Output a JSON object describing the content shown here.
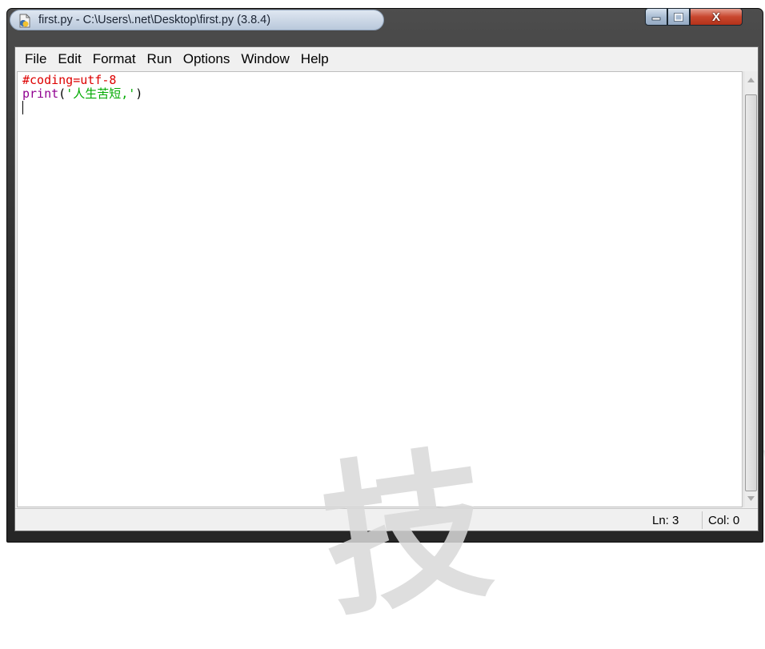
{
  "window": {
    "title": "first.py - C:\\Users\\.net\\Desktop\\first.py (3.8.4)",
    "app_icon": "python-file-icon"
  },
  "caption_buttons": {
    "minimize_icon": "minimize-icon",
    "maximize_icon": "maximize-icon",
    "close_label": "X"
  },
  "menu": {
    "items": [
      {
        "label": "File"
      },
      {
        "label": "Edit"
      },
      {
        "label": "Format"
      },
      {
        "label": "Run"
      },
      {
        "label": "Options"
      },
      {
        "label": "Window"
      },
      {
        "label": "Help"
      }
    ]
  },
  "editor": {
    "line1": {
      "comment": "#coding=utf-8"
    },
    "line2": {
      "builtin": "print",
      "open": "(",
      "string": "'人生苦短,'",
      "close": ")"
    }
  },
  "status": {
    "ln": "Ln: 3",
    "col": "Col: 0"
  },
  "watermark": {
    "text": "技 t"
  },
  "colors": {
    "comment": "#dd0000",
    "builtin": "#900090",
    "string": "#00aa00",
    "close_button": "#c8472e"
  }
}
